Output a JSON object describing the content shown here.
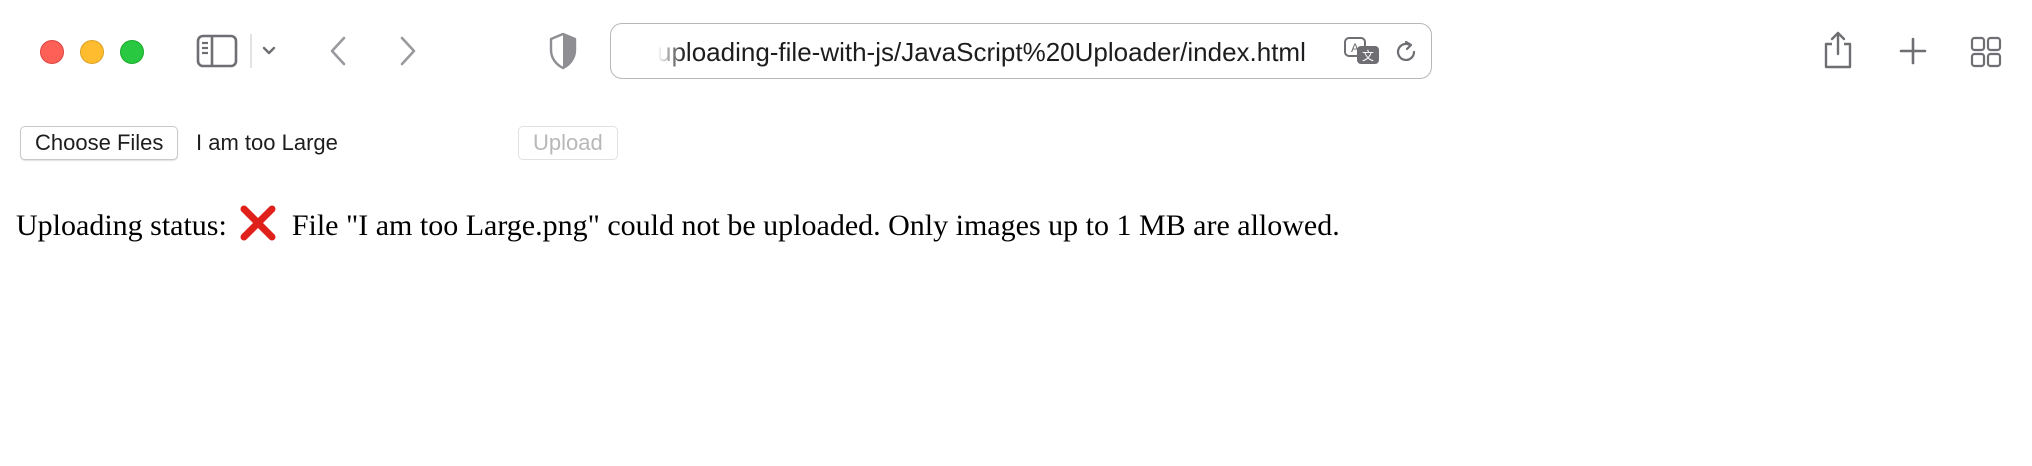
{
  "browser": {
    "url": "uploading-file-with-js/JavaScript%20Uploader/index.html",
    "icons": {
      "sidebar": "sidebar-icon",
      "sidebar_menu": "chevron-down-icon",
      "back": "chevron-left-icon",
      "forward": "chevron-right-icon",
      "privacy": "shield-icon",
      "translate": "translate-icon",
      "reload": "reload-icon",
      "share": "share-icon",
      "new_tab": "plus-icon",
      "tab_overview": "grid-icon"
    },
    "colors": {
      "close": "#fe5f57",
      "minimize": "#febc2e",
      "maximize": "#28c840"
    }
  },
  "page": {
    "choose_files_label": "Choose Files",
    "selected_file_name": "I am too Large",
    "upload_label": "Upload",
    "status_label": "Uploading status:",
    "status_icon": "cross-mark-icon",
    "status_message": "File \"I am too Large.png\" could not be uploaded. Only images up to 1 MB are allowed.",
    "colors": {
      "error_icon": "#e0201b",
      "disabled_text": "#b8b8b8"
    }
  }
}
